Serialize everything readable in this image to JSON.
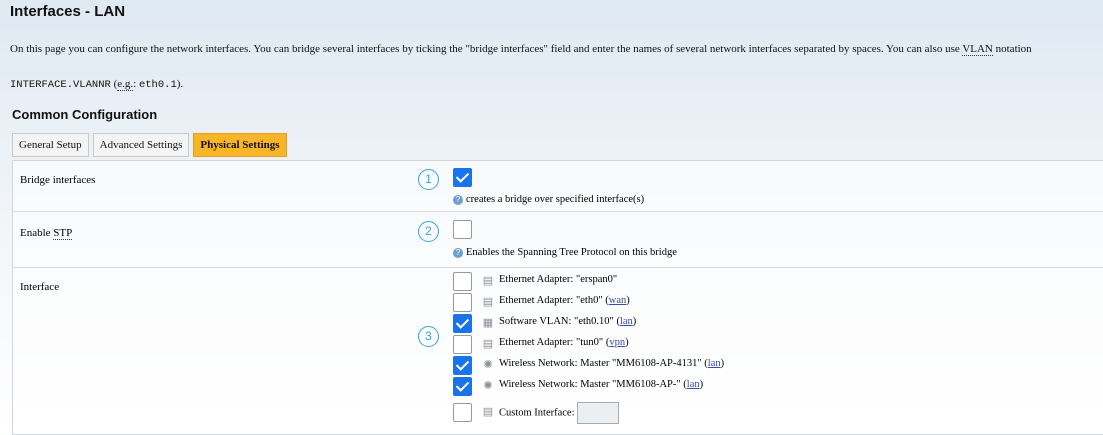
{
  "page": {
    "title": "Interfaces - LAN",
    "intro_a": "On this page you can configure the network interfaces. You can bridge several interfaces by ticking the \"bridge interfaces\" field and enter the names of several network interfaces separated by spaces. You can also use ",
    "intro_vlan": "VLAN",
    "intro_b": " notation",
    "intro2_code": "INTERFACE.VLANNR",
    "intro2_a": " (",
    "intro2_eg": "e.g.",
    "intro2_b": ": ",
    "intro2_code2": "eth0.1",
    "intro2_c": ")."
  },
  "section": {
    "title": "Common Configuration"
  },
  "tabs": [
    {
      "label": "General Setup",
      "active": false
    },
    {
      "label": "Advanced Settings",
      "active": false
    },
    {
      "label": "Physical Settings",
      "active": true
    }
  ],
  "fields": {
    "bridge": {
      "label": "Bridge interfaces",
      "checked": true,
      "help": "creates a bridge over specified interface(s)",
      "marker": "1"
    },
    "stp": {
      "label_a": "Enable ",
      "label_abbr": "STP",
      "checked": false,
      "help": "Enables the Spanning Tree Protocol on this bridge",
      "marker": "2"
    },
    "interface": {
      "label": "Interface",
      "marker": "3",
      "items": [
        {
          "text": "Ethernet Adapter: \"erspan0\"",
          "link": "",
          "checked": false,
          "icon": "ethernet-icon"
        },
        {
          "text": "Ethernet Adapter: \"eth0\" (",
          "link": "wan",
          "tail": ")",
          "checked": false,
          "icon": "ethernet-icon"
        },
        {
          "text": "Software VLAN: \"eth0.10\" (",
          "link": "lan",
          "tail": ")",
          "checked": true,
          "icon": "vlan-icon"
        },
        {
          "text": "Ethernet Adapter: \"tun0\" (",
          "link": "vpn",
          "tail": ")",
          "checked": false,
          "icon": "ethernet-icon"
        },
        {
          "text": "Wireless Network: Master \"MM6108-AP-4131\" (",
          "link": "lan",
          "tail": ")",
          "checked": true,
          "icon": "wireless-icon"
        },
        {
          "text": "Wireless Network: Master \"MM6108-AP-\" (",
          "link": "lan",
          "tail": ")",
          "checked": true,
          "icon": "wireless-icon"
        },
        {
          "text": "Custom Interface:",
          "link": "",
          "checked": false,
          "icon": "ethernet-icon",
          "custom_value": ""
        }
      ]
    }
  },
  "colors": {
    "accent": "#f8b527",
    "check": "#1a73e8",
    "marker": "#2fa6d9"
  }
}
